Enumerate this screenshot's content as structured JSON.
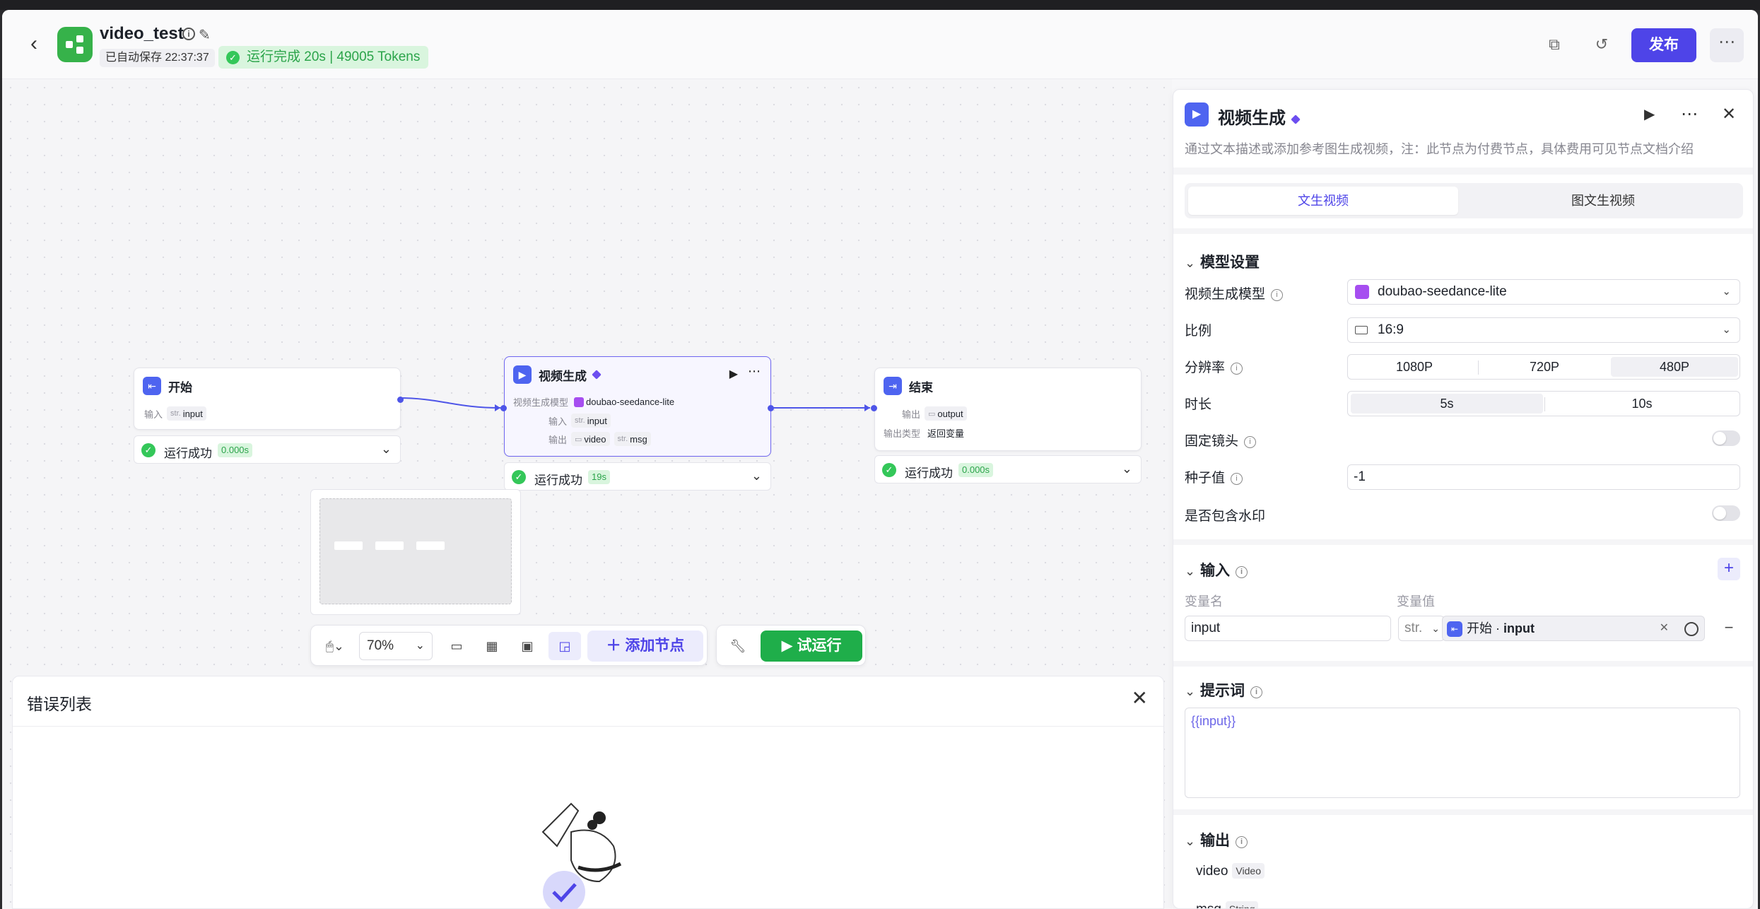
{
  "header": {
    "app_title": "video_test",
    "saved_text": "已自动保存 22:37:37",
    "run_status": "运行完成 20s | 49005 Tokens",
    "publish_label": "发布",
    "more_label": "⋯",
    "icons": [
      "info-icon",
      "edit-icon",
      "copy-icon",
      "history-icon"
    ]
  },
  "canvas": {
    "nodes": {
      "start": {
        "title": "开始",
        "input_label": "输入",
        "input_type": "str.",
        "input_name": "input",
        "status": "运行成功",
        "time": "0.000s"
      },
      "video": {
        "title": "视频生成",
        "model_label": "视频生成模型",
        "model_name": "doubao-seedance-lite",
        "input_label": "输入",
        "input_type": "str.",
        "input_name": "input",
        "output_label": "输出",
        "output_1": "video",
        "output_2_type": "str.",
        "output_2": "msg",
        "status": "运行成功",
        "time": "19s"
      },
      "end": {
        "title": "结束",
        "output_label": "输出",
        "output_name": "output",
        "output_type_label": "输出类型",
        "output_type": "返回变量",
        "status": "运行成功",
        "time": "0.000s"
      }
    },
    "toolbar": {
      "zoom": "70%",
      "add_node_label": "添加节点",
      "trial_run_label": "试运行"
    }
  },
  "error_panel": {
    "title": "错误列表"
  },
  "panel": {
    "title": "视频生成",
    "description": "通过文本描述或添加参考图生成视频，注：此节点为付费节点，具体费用可见节点文档介绍",
    "tabs": [
      {
        "label": "文生视频",
        "active": true
      },
      {
        "label": "图文生视频",
        "active": false
      }
    ],
    "model_section": {
      "title": "模型设置",
      "model_label": "视频生成模型",
      "model_value": "doubao-seedance-lite",
      "ratio_label": "比例",
      "ratio_value": "16:9",
      "resolution_label": "分辨率",
      "resolution_options": [
        "1080P",
        "720P",
        "480P"
      ],
      "resolution_selected": "480P",
      "duration_label": "时长",
      "duration_options": [
        "5s",
        "10s"
      ],
      "duration_selected": "5s",
      "fixed_camera_label": "固定镜头",
      "fixed_camera_on": false,
      "seed_label": "种子值",
      "seed_value": "-1",
      "watermark_label": "是否包含水印",
      "watermark_on": false
    },
    "input_section": {
      "title": "输入",
      "col_name": "变量名",
      "col_value": "变量值",
      "var_name": "input",
      "var_type": "str.",
      "ref_node": "开始",
      "ref_sep": "·",
      "ref_var": "input"
    },
    "prompt_section": {
      "title": "提示词",
      "value": "{{input}}"
    },
    "output_section": {
      "title": "输出",
      "items": [
        {
          "name": "video",
          "type": "Video"
        },
        {
          "name": "msg",
          "type": "String"
        }
      ]
    }
  },
  "colors": {
    "accent": "#4e44e8",
    "success": "#34c759",
    "node_icon": "#4e64f0",
    "run_button": "#1fae4a"
  }
}
